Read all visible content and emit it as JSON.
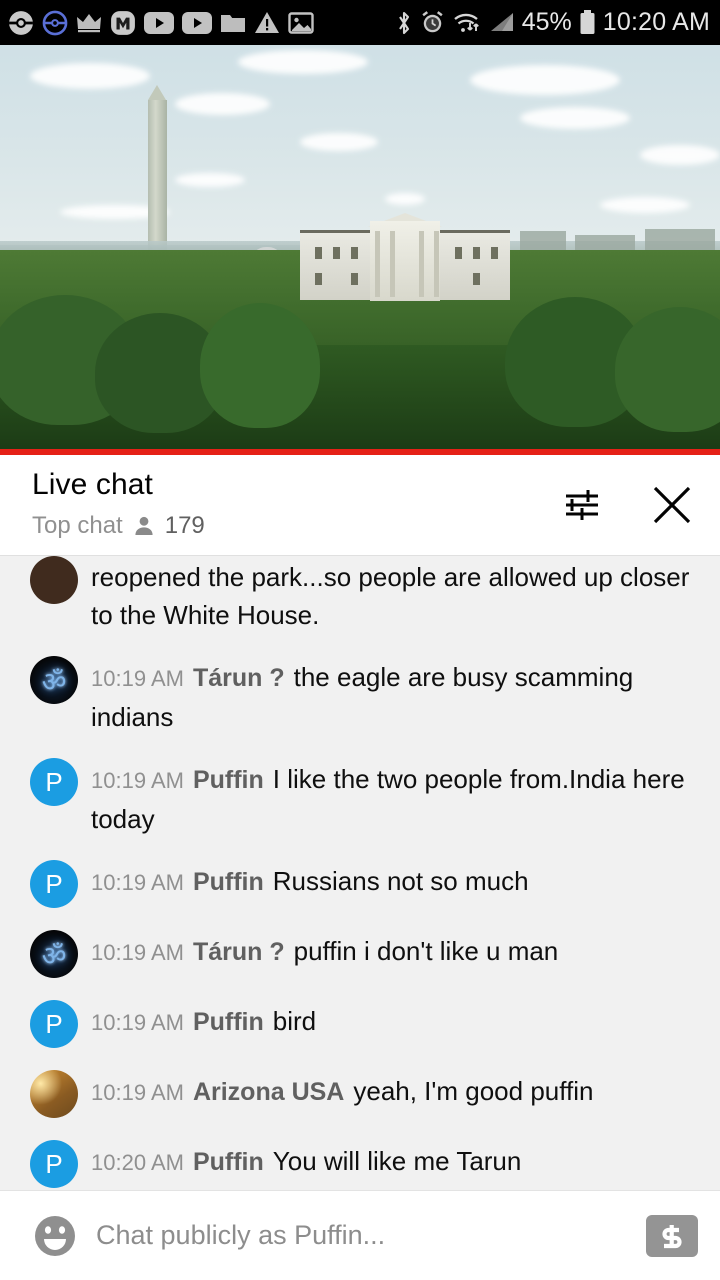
{
  "statusbar": {
    "icons_left": [
      "pokeball-icon",
      "pokeball-outline-icon",
      "crown-icon",
      "m-logo-icon",
      "youtube-play-icon",
      "youtube-play-icon-2",
      "folder-icon",
      "warning-triangle-icon",
      "image-icon"
    ],
    "icons_right": [
      "bluetooth-icon",
      "alarm-clock-icon",
      "wifi-icon",
      "cell-signal-icon",
      "battery-icon"
    ],
    "battery_text": "45%",
    "time": "10:20 AM"
  },
  "video": {
    "name": "white-house-live-stream",
    "progress_color": "#e52117"
  },
  "chat_header": {
    "title": "Live chat",
    "mode": "Top chat",
    "viewer_icon": "person-icon",
    "viewer_count": "179",
    "settings_icon": "tune-sliders-icon",
    "close_icon": "close-icon"
  },
  "messages": [
    {
      "avatar_type": "dark",
      "avatar_letter": "",
      "time": "",
      "author": "",
      "text": "reopened the park...so people are allowed up closer to the White House.",
      "clipped": true
    },
    {
      "avatar_type": "om",
      "avatar_letter": "ॐ",
      "time": "10:19 AM",
      "author": "Tárun ?",
      "text": "the eagle are busy scamming indians"
    },
    {
      "avatar_type": "blue",
      "avatar_letter": "P",
      "time": "10:19 AM",
      "author": "Puffin",
      "text": "I like the two people from.India here today"
    },
    {
      "avatar_type": "blue",
      "avatar_letter": "P",
      "time": "10:19 AM",
      "author": "Puffin",
      "text": "Russians not so much"
    },
    {
      "avatar_type": "om",
      "avatar_letter": "ॐ",
      "time": "10:19 AM",
      "author": "Tárun ?",
      "text": "puffin i don't like u man"
    },
    {
      "avatar_type": "blue",
      "avatar_letter": "P",
      "time": "10:19 AM",
      "author": "Puffin",
      "text": "bird"
    },
    {
      "avatar_type": "photo",
      "avatar_letter": "",
      "time": "10:19 AM",
      "author": "Arizona USA",
      "text": "yeah, I'm good puffin"
    },
    {
      "avatar_type": "blue",
      "avatar_letter": "P",
      "time": "10:20 AM",
      "author": "Puffin",
      "text": "You will like me Tarun"
    }
  ],
  "chat_input": {
    "emoji_icon": "emoji-smiley-icon",
    "placeholder": "Chat publicly as Puffin...",
    "superchat_icon": "dollar-sign-icon"
  },
  "colors": {
    "accent_blue": "#1b9de2",
    "youtube_red": "#e52117",
    "chat_bg": "#f1f1f1",
    "muted_text": "#909090"
  }
}
